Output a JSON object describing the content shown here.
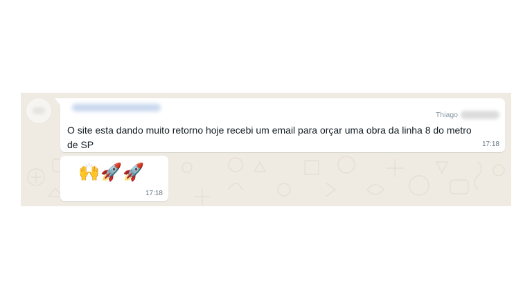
{
  "chat": {
    "messages": [
      {
        "sender_name": "Thiago",
        "text": "O site esta dando muito retorno hoje recebi um email para orçar uma obra da linha 8 do metro de SP",
        "time": "17:18"
      },
      {
        "emojis": "🙌🚀🚀",
        "time": "17:18"
      }
    ]
  },
  "icons": {
    "avatar": "contact-avatar-icon"
  },
  "colors": {
    "chat_background": "#efeae2",
    "bubble": "#ffffff",
    "text": "#111b21",
    "meta_text": "#667781"
  }
}
